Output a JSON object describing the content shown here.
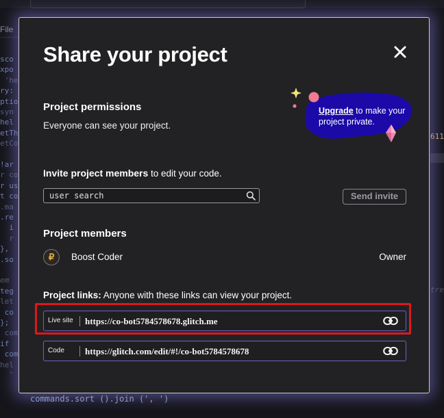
{
  "editor": {
    "file_tab": "File",
    "code_lines": [
      "sco",
      "xpo",
      " 'he",
      "ry:",
      "ptio",
      "syn",
      "hel",
      "etTh",
      "etCo",
      "",
      "!ar",
      "r co",
      "r us",
      "t co",
      ".ma",
      ".re",
      "  i",
      "  r",
      "},",
      ".so",
      "",
      "em",
      "teg",
      "let",
      " co",
      "};",
      " com",
      "if",
      " com",
      "hel",
      "  `"
    ],
    "right_number": "611",
    "right_comment": "tre",
    "bottom_code": "commands.sort ().join (', ')"
  },
  "modal": {
    "title": "Share your project",
    "close_icon": "close-icon",
    "permissions": {
      "title": "Project permissions",
      "description": "Everyone can see your project."
    },
    "upsell": {
      "link": "Upgrade",
      "text": " to make your project private.",
      "colors": {
        "blob": "#1b0aa8",
        "dot": "#f27a94",
        "crystal": "#f088b0",
        "sparkle": "#f5e57a"
      }
    },
    "invite": {
      "bold": "Invite project members",
      "rest": " to edit your code.",
      "placeholder": "user search",
      "send_label": "Send invite"
    },
    "members": {
      "title": "Project members",
      "list": [
        {
          "avatar_letter": "₽",
          "name": "Boost Coder",
          "role": "Owner"
        }
      ]
    },
    "links": {
      "bold": "Project links:",
      "rest": " Anyone with these links can view your project.",
      "items": [
        {
          "label": "Live site",
          "url": "https://co-bot5784578678.glitch.me"
        },
        {
          "label": "Code",
          "url": "https://glitch.com/edit/#!/co-bot5784578678"
        }
      ]
    },
    "accent_color": "#6d62c6",
    "highlight_color": "#e0171d"
  }
}
